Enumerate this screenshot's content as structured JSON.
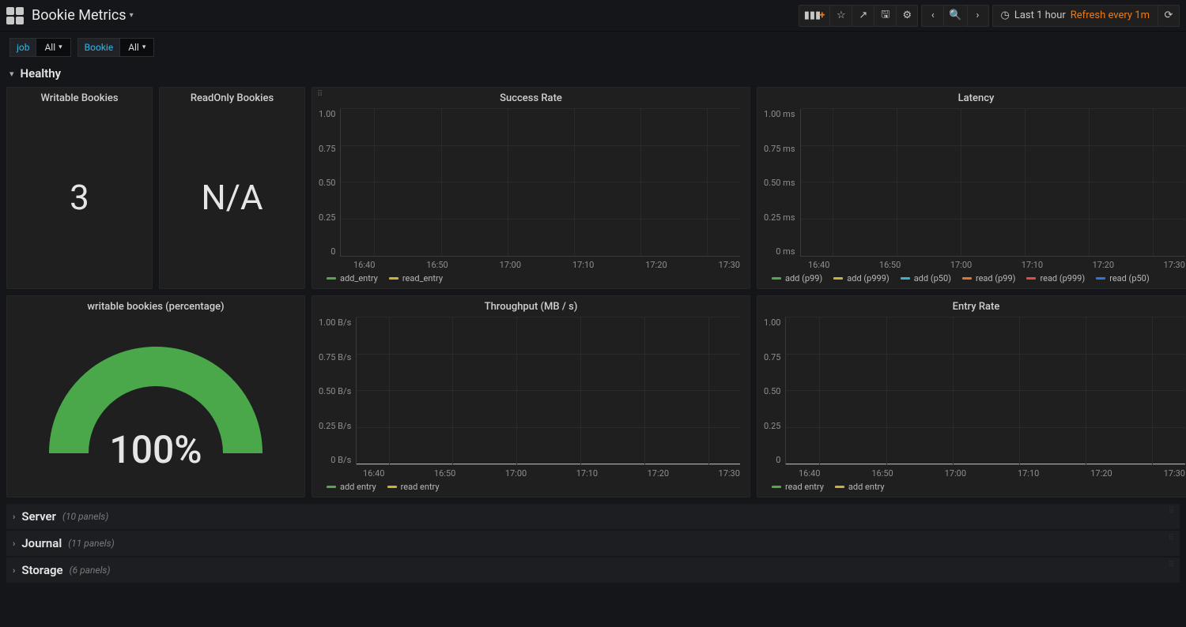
{
  "header": {
    "title": "Bookie Metrics",
    "time_range": "Last 1 hour",
    "refresh": "Refresh every 1m"
  },
  "variables": [
    {
      "label": "job",
      "value": "All"
    },
    {
      "label": "Bookie",
      "value": "All"
    }
  ],
  "rows": {
    "healthy": {
      "title": "Healthy"
    },
    "collapsed": [
      {
        "title": "Server",
        "meta": "(10 panels)"
      },
      {
        "title": "Journal",
        "meta": "(11 panels)"
      },
      {
        "title": "Storage",
        "meta": "(6 panels)"
      }
    ]
  },
  "panels": {
    "writable": {
      "title": "Writable Bookies",
      "value": "3"
    },
    "readonly": {
      "title": "ReadOnly Bookies",
      "value": "N/A"
    },
    "success": {
      "title": "Success Rate",
      "legend": [
        {
          "name": "add_entry",
          "color": "#56a64b"
        },
        {
          "name": "read_entry",
          "color": "#cbb13b"
        }
      ]
    },
    "latency": {
      "title": "Latency",
      "legend": [
        {
          "name": "add (p99)",
          "color": "#56a64b"
        },
        {
          "name": "add (p999)",
          "color": "#cbb13b"
        },
        {
          "name": "add (p50)",
          "color": "#3eb0c8"
        },
        {
          "name": "read (p99)",
          "color": "#e0752d"
        },
        {
          "name": "read (p999)",
          "color": "#e24d42"
        },
        {
          "name": "read (p50)",
          "color": "#3274d9"
        }
      ]
    },
    "gauge": {
      "title": "writable bookies (percentage)",
      "value": "100%"
    },
    "throughput": {
      "title": "Throughput (MB / s)",
      "legend": [
        {
          "name": "add entry",
          "color": "#56a64b"
        },
        {
          "name": "read entry",
          "color": "#cbb13b"
        }
      ]
    },
    "entryrate": {
      "title": "Entry Rate",
      "legend": [
        {
          "name": "read entry",
          "color": "#56a64b"
        },
        {
          "name": "add entry",
          "color": "#cbb13b"
        }
      ]
    }
  },
  "chart_data": [
    {
      "panel": "success",
      "type": "line",
      "title": "Success Rate",
      "xlabel": "",
      "ylabel": "",
      "x_ticks": [
        "16:40",
        "16:50",
        "17:00",
        "17:10",
        "17:20",
        "17:30"
      ],
      "y_ticks": [
        "0",
        "0.25",
        "0.50",
        "0.75",
        "1.00"
      ],
      "ylim": [
        0,
        1
      ],
      "series": [
        {
          "name": "add_entry",
          "values": []
        },
        {
          "name": "read_entry",
          "values": []
        }
      ]
    },
    {
      "panel": "latency",
      "type": "line",
      "title": "Latency",
      "xlabel": "",
      "ylabel": "",
      "x_ticks": [
        "16:40",
        "16:50",
        "17:00",
        "17:10",
        "17:20",
        "17:30"
      ],
      "y_ticks": [
        "0 ms",
        "0.25 ms",
        "0.50 ms",
        "0.75 ms",
        "1.00 ms"
      ],
      "ylim": [
        0,
        1
      ],
      "series": [
        {
          "name": "add (p99)",
          "values": []
        },
        {
          "name": "add (p999)",
          "values": []
        },
        {
          "name": "add (p50)",
          "values": []
        },
        {
          "name": "read (p99)",
          "values": []
        },
        {
          "name": "read (p999)",
          "values": []
        },
        {
          "name": "read (p50)",
          "values": []
        }
      ]
    },
    {
      "panel": "throughput",
      "type": "line",
      "title": "Throughput (MB / s)",
      "xlabel": "",
      "ylabel": "",
      "x_ticks": [
        "16:40",
        "16:50",
        "17:00",
        "17:10",
        "17:20",
        "17:30"
      ],
      "y_ticks": [
        "0 B/s",
        "0.25 B/s",
        "0.50 B/s",
        "0.75 B/s",
        "1.00 B/s"
      ],
      "ylim": [
        0,
        1
      ],
      "series": [
        {
          "name": "add entry",
          "values": [
            0,
            0,
            0,
            0,
            0,
            0
          ]
        },
        {
          "name": "read entry",
          "values": [
            0,
            0,
            0,
            0,
            0,
            0
          ]
        }
      ]
    },
    {
      "panel": "entryrate",
      "type": "line",
      "title": "Entry Rate",
      "xlabel": "",
      "ylabel": "",
      "x_ticks": [
        "16:40",
        "16:50",
        "17:00",
        "17:10",
        "17:20",
        "17:30"
      ],
      "y_ticks": [
        "0",
        "0.25",
        "0.50",
        "0.75",
        "1.00"
      ],
      "ylim": [
        0,
        1
      ],
      "series": [
        {
          "name": "read entry",
          "values": [
            0,
            0,
            0,
            0,
            0,
            0
          ]
        },
        {
          "name": "add entry",
          "values": [
            0,
            0,
            0,
            0,
            0,
            0
          ]
        }
      ]
    }
  ]
}
